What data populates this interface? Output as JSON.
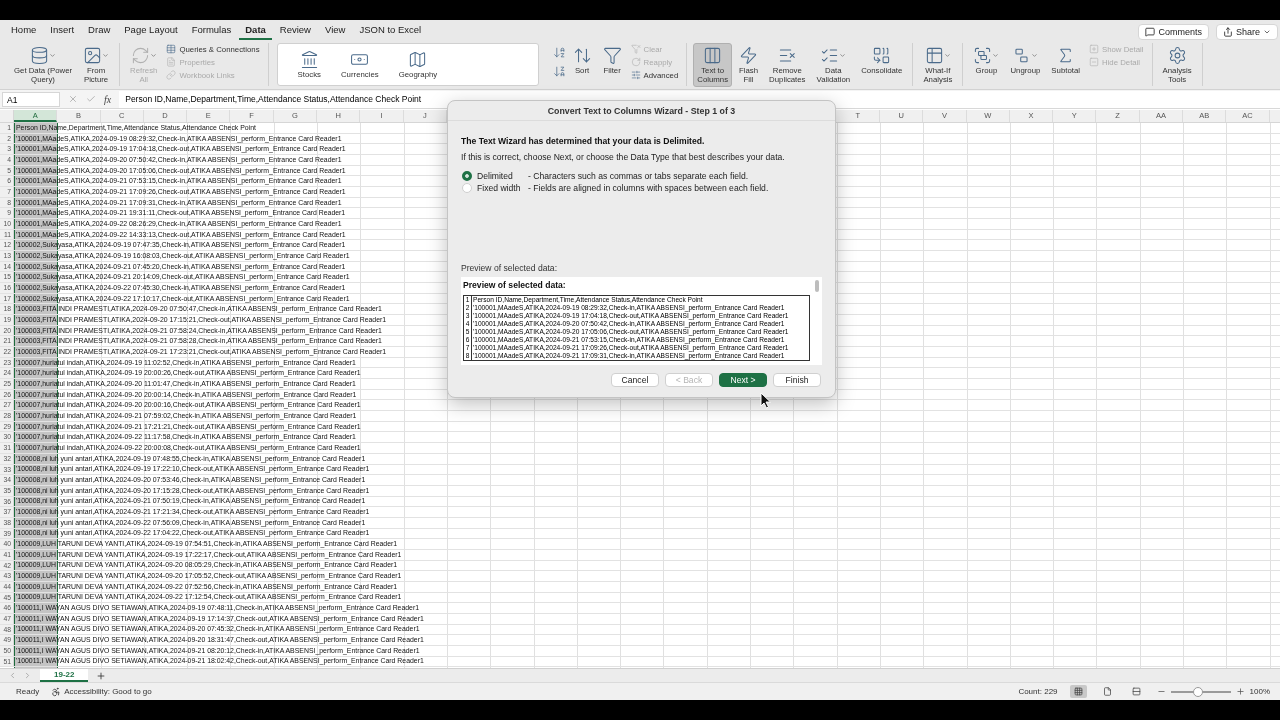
{
  "menu_tabs": [
    {
      "label": "Home",
      "selected": false
    },
    {
      "label": "Insert",
      "selected": false
    },
    {
      "label": "Draw",
      "selected": false
    },
    {
      "label": "Page Layout",
      "selected": false
    },
    {
      "label": "Formulas",
      "selected": false
    },
    {
      "label": "Data",
      "selected": true
    },
    {
      "label": "Review",
      "selected": false
    },
    {
      "label": "View",
      "selected": false
    },
    {
      "label": "JSON to Excel",
      "selected": false
    }
  ],
  "header_buttons": [
    {
      "label": "Comments",
      "kind": "comments"
    },
    {
      "label": "Share",
      "kind": "share"
    }
  ],
  "ribbon": [
    {
      "kind": "plain",
      "items": [
        {
          "label": "Get Data (Power\nQuery)",
          "kind": "large",
          "menu": true,
          "disabled": false,
          "pressed": false
        },
        {
          "label": "From\nPicture",
          "kind": "large",
          "menu": true,
          "disabled": false,
          "pressed": false
        }
      ]
    },
    {
      "kind": "plain",
      "items": [
        {
          "label": "Refresh\nAll",
          "kind": "large",
          "menu": true,
          "disabled": true,
          "pressed": false
        },
        {
          "label": "Queries & Connections",
          "kind": "small",
          "menu": false,
          "disabled": false,
          "pressed": false
        },
        {
          "label": "Properties",
          "kind": "small",
          "menu": false,
          "disabled": true,
          "pressed": false
        },
        {
          "label": "Workbook Links",
          "kind": "small",
          "menu": false,
          "disabled": true,
          "pressed": false
        }
      ]
    },
    {
      "kind": "panel",
      "items": [
        {
          "label": "Stocks",
          "kind": "large",
          "menu": false,
          "disabled": false,
          "pressed": false
        },
        {
          "label": "Currencies",
          "kind": "large",
          "menu": false,
          "disabled": false,
          "pressed": false
        },
        {
          "label": "Geography",
          "kind": "large",
          "menu": false,
          "disabled": false,
          "pressed": false
        }
      ]
    },
    {
      "kind": "sort",
      "items": [
        {
          "label": "Sort",
          "kind": "large",
          "menu": false,
          "disabled": false,
          "pressed": false
        },
        {
          "label": "Filter",
          "kind": "large",
          "menu": false,
          "disabled": false,
          "pressed": false
        },
        {
          "label": "Clear",
          "kind": "small",
          "menu": false,
          "disabled": true,
          "pressed": false
        },
        {
          "label": "Reapply",
          "kind": "small",
          "menu": false,
          "disabled": true,
          "pressed": false
        },
        {
          "label": "Advanced",
          "kind": "small",
          "menu": false,
          "disabled": false,
          "pressed": false
        }
      ]
    },
    {
      "kind": "plain",
      "items": [
        {
          "label": "Text to\nColumns",
          "kind": "large",
          "menu": false,
          "disabled": false,
          "pressed": true
        },
        {
          "label": "Flash\nFill",
          "kind": "large",
          "menu": false,
          "disabled": false,
          "pressed": false
        },
        {
          "label": "Remove\nDuplicates",
          "kind": "large",
          "menu": false,
          "disabled": false,
          "pressed": false
        },
        {
          "label": "Data\nValidation",
          "kind": "large",
          "menu": true,
          "disabled": false,
          "pressed": false
        },
        {
          "label": "Consolidate",
          "kind": "large",
          "menu": false,
          "disabled": false,
          "pressed": false
        }
      ]
    },
    {
      "kind": "plain",
      "items": [
        {
          "label": "What-If\nAnalysis",
          "kind": "large",
          "menu": true,
          "disabled": false,
          "pressed": false
        }
      ]
    },
    {
      "kind": "plain",
      "items": [
        {
          "label": "Group",
          "kind": "large",
          "menu": true,
          "disabled": false,
          "pressed": false
        },
        {
          "label": "Ungroup",
          "kind": "large",
          "menu": true,
          "disabled": false,
          "pressed": false
        },
        {
          "label": "Subtotal",
          "kind": "large",
          "menu": false,
          "disabled": false,
          "pressed": false
        },
        {
          "label": "Show Detail",
          "kind": "small",
          "menu": false,
          "disabled": true,
          "pressed": false
        },
        {
          "label": "Hide Detail",
          "kind": "small",
          "menu": false,
          "disabled": true,
          "pressed": false
        }
      ]
    },
    {
      "kind": "plain",
      "items": [
        {
          "label": "Analysis\nTools",
          "kind": "large",
          "menu": false,
          "disabled": false,
          "pressed": false
        }
      ]
    }
  ],
  "formula_bar": {
    "name_box": "A1",
    "function_button": "fx",
    "formula": "Person ID,Name,Department,Time,Attendance Status,Attendance Check Point"
  },
  "column_headers_left": [
    {
      "label": "A",
      "selected": true
    },
    {
      "label": "B",
      "selected": false
    },
    {
      "label": "C",
      "selected": false
    },
    {
      "label": "D",
      "selected": false
    },
    {
      "label": "E",
      "selected": false
    },
    {
      "label": "F",
      "selected": false
    },
    {
      "label": "G",
      "selected": false
    },
    {
      "label": "H",
      "selected": false
    },
    {
      "label": "I",
      "selected": false
    },
    {
      "label": "J",
      "selected": false
    }
  ],
  "column_headers_right": [
    {
      "label": "T",
      "selected": false
    },
    {
      "label": "U",
      "selected": false
    },
    {
      "label": "V",
      "selected": false
    },
    {
      "label": "W",
      "selected": false
    },
    {
      "label": "X",
      "selected": false
    },
    {
      "label": "Y",
      "selected": false
    },
    {
      "label": "Z",
      "selected": false
    },
    {
      "label": "AA",
      "selected": false
    },
    {
      "label": "AB",
      "selected": false
    },
    {
      "label": "AC",
      "selected": false
    }
  ],
  "rows": [
    {
      "number": "1",
      "text": "Person ID,Name,Department,Time,Attendance Status,Attendance Check Point"
    },
    {
      "number": "2",
      "text": "'100001,MAadeS,ATIKA,2024-09-19 08:29:32,Check-in,ATIKA ABSENSI_perform_Entrance Card Reader1"
    },
    {
      "number": "3",
      "text": "'100001,MAadeS,ATIKA,2024-09-19 17:04:18,Check-out,ATIKA ABSENSI_perform_Entrance Card Reader1"
    },
    {
      "number": "4",
      "text": "'100001,MAadeS,ATIKA,2024-09-20 07:50:42,Check-in,ATIKA ABSENSI_perform_Entrance Card Reader1"
    },
    {
      "number": "5",
      "text": "'100001,MAadeS,ATIKA,2024-09-20 17:05:06,Check-out,ATIKA ABSENSI_perform_Entrance Card Reader1"
    },
    {
      "number": "6",
      "text": "'100001,MAadeS,ATIKA,2024-09-21 07:53:15,Check-in,ATIKA ABSENSI_perform_Entrance Card Reader1"
    },
    {
      "number": "7",
      "text": "'100001,MAadeS,ATIKA,2024-09-21 17:09:26,Check-out,ATIKA ABSENSI_perform_Entrance Card Reader1"
    },
    {
      "number": "8",
      "text": "'100001,MAadeS,ATIKA,2024-09-21 17:09:31,Check-in,ATIKA ABSENSI_perform_Entrance Card Reader1"
    },
    {
      "number": "9",
      "text": "'100001,MAadeS,ATIKA,2024-09-21 19:31:11,Check-out,ATIKA ABSENSI_perform_Entrance Card Reader1"
    },
    {
      "number": "10",
      "text": "'100001,MAadeS,ATIKA,2024-09-22 08:26:29,Check-in,ATIKA ABSENSI_perform_Entrance Card Reader1"
    },
    {
      "number": "11",
      "text": "'100001,MAadeS,ATIKA,2024-09-22 14:33:13,Check-out,ATIKA ABSENSI_perform_Entrance Card Reader1"
    },
    {
      "number": "12",
      "text": "'100002,Sukayasa,ATIKA,2024-09-19 07:47:35,Check-in,ATIKA ABSENSI_perform_Entrance Card Reader1"
    },
    {
      "number": "13",
      "text": "'100002,Sukayasa,ATIKA,2024-09-19 16:08:03,Check-out,ATIKA ABSENSI_perform_Entrance Card Reader1"
    },
    {
      "number": "14",
      "text": "'100002,Sukayasa,ATIKA,2024-09-21 07:45:20,Check-in,ATIKA ABSENSI_perform_Entrance Card Reader1"
    },
    {
      "number": "15",
      "text": "'100002,Sukayasa,ATIKA,2024-09-21 20:14:09,Check-out,ATIKA ABSENSI_perform_Entrance Card Reader1"
    },
    {
      "number": "16",
      "text": "'100002,Sukayasa,ATIKA,2024-09-22 07:45:30,Check-in,ATIKA ABSENSI_perform_Entrance Card Reader1"
    },
    {
      "number": "17",
      "text": "'100002,Sukayasa,ATIKA,2024-09-22 17:10:17,Check-out,ATIKA ABSENSI_perform_Entrance Card Reader1"
    },
    {
      "number": "18",
      "text": "'100003,FITA INDI PRAMESTI,ATIKA,2024-09-20 07:50:47,Check-in,ATIKA ABSENSI_perform_Entrance Card Reader1"
    },
    {
      "number": "19",
      "text": "'100003,FITA INDI PRAMESTI,ATIKA,2024-09-20 17:15:21,Check-out,ATIKA ABSENSI_perform_Entrance Card Reader1"
    },
    {
      "number": "20",
      "text": "'100003,FITA INDI PRAMESTI,ATIKA,2024-09-21 07:58:24,Check-in,ATIKA ABSENSI_perform_Entrance Card Reader1"
    },
    {
      "number": "21",
      "text": "'100003,FITA INDI PRAMESTI,ATIKA,2024-09-21 07:58:28,Check-in,ATIKA ABSENSI_perform_Entrance Card Reader1"
    },
    {
      "number": "22",
      "text": "'100003,FITA INDI PRAMESTI,ATIKA,2024-09-21 17:23:21,Check-out,ATIKA ABSENSI_perform_Entrance Card Reader1"
    },
    {
      "number": "23",
      "text": "'100007,huriatul indah,ATIKA,2024-09-19 11:02:52,Check-in,ATIKA ABSENSI_perform_Entrance Card Reader1"
    },
    {
      "number": "24",
      "text": "'100007,huriatul indah,ATIKA,2024-09-19 20:00:26,Check-out,ATIKA ABSENSI_perform_Entrance Card Reader1"
    },
    {
      "number": "25",
      "text": "'100007,huriatul indah,ATIKA,2024-09-20 11:01:47,Check-in,ATIKA ABSENSI_perform_Entrance Card Reader1"
    },
    {
      "number": "26",
      "text": "'100007,huriatul indah,ATIKA,2024-09-20 20:00:14,Check-in,ATIKA ABSENSI_perform_Entrance Card Reader1"
    },
    {
      "number": "27",
      "text": "'100007,huriatul indah,ATIKA,2024-09-20 20:00:16,Check-out,ATIKA ABSENSI_perform_Entrance Card Reader1"
    },
    {
      "number": "28",
      "text": "'100007,huriatul indah,ATIKA,2024-09-21 07:59:02,Check-in,ATIKA ABSENSI_perform_Entrance Card Reader1"
    },
    {
      "number": "29",
      "text": "'100007,huriatul indah,ATIKA,2024-09-21 17:21:21,Check-out,ATIKA ABSENSI_perform_Entrance Card Reader1"
    },
    {
      "number": "30",
      "text": "'100007,huriatul indah,ATIKA,2024-09-22 11:17:58,Check-in,ATIKA ABSENSI_perform_Entrance Card Reader1"
    },
    {
      "number": "31",
      "text": "'100007,huriatul indah,ATIKA,2024-09-22 20:00:08,Check-out,ATIKA ABSENSI_perform_Entrance Card Reader1"
    },
    {
      "number": "32",
      "text": "'100008,ni luh yuni antari,ATIKA,2024-09-19 07:48:55,Check-in,ATIKA ABSENSI_perform_Entrance Card Reader1"
    },
    {
      "number": "33",
      "text": "'100008,ni luh yuni antari,ATIKA,2024-09-19 17:22:10,Check-out,ATIKA ABSENSI_perform_Entrance Card Reader1"
    },
    {
      "number": "34",
      "text": "'100008,ni luh yuni antari,ATIKA,2024-09-20 07:53:46,Check-in,ATIKA ABSENSI_perform_Entrance Card Reader1"
    },
    {
      "number": "35",
      "text": "'100008,ni luh yuni antari,ATIKA,2024-09-20 17:15:28,Check-out,ATIKA ABSENSI_perform_Entrance Card Reader1"
    },
    {
      "number": "36",
      "text": "'100008,ni luh yuni antari,ATIKA,2024-09-21 07:50:19,Check-in,ATIKA ABSENSI_perform_Entrance Card Reader1"
    },
    {
      "number": "37",
      "text": "'100008,ni luh yuni antari,ATIKA,2024-09-21 17:21:34,Check-out,ATIKA ABSENSI_perform_Entrance Card Reader1"
    },
    {
      "number": "38",
      "text": "'100008,ni luh yuni antari,ATIKA,2024-09-22 07:56:09,Check-in,ATIKA ABSENSI_perform_Entrance Card Reader1"
    },
    {
      "number": "39",
      "text": "'100008,ni luh yuni antari,ATIKA,2024-09-22 17:04:22,Check-out,ATIKA ABSENSI_perform_Entrance Card Reader1"
    },
    {
      "number": "40",
      "text": "'100009,LUH TARUNI DEVA YANTI,ATIKA,2024-09-19 07:54:51,Check-in,ATIKA ABSENSI_perform_Entrance Card Reader1"
    },
    {
      "number": "41",
      "text": "'100009,LUH TARUNI DEVA YANTI,ATIKA,2024-09-19 17:22:17,Check-out,ATIKA ABSENSI_perform_Entrance Card Reader1"
    },
    {
      "number": "42",
      "text": "'100009,LUH TARUNI DEVA YANTI,ATIKA,2024-09-20 08:05:29,Check-in,ATIKA ABSENSI_perform_Entrance Card Reader1"
    },
    {
      "number": "43",
      "text": "'100009,LUH TARUNI DEVA YANTI,ATIKA,2024-09-20 17:05:52,Check-out,ATIKA ABSENSI_perform_Entrance Card Reader1"
    },
    {
      "number": "44",
      "text": "'100009,LUH TARUNI DEVA YANTI,ATIKA,2024-09-22 07:52:56,Check-in,ATIKA ABSENSI_perform_Entrance Card Reader1"
    },
    {
      "number": "45",
      "text": "'100009,LUH TARUNI DEVA YANTI,ATIKA,2024-09-22 17:12:54,Check-out,ATIKA ABSENSI_perform_Entrance Card Reader1"
    },
    {
      "number": "46",
      "text": "'100011,I WAYAN AGUS DIVO SETIAWAN,ATIKA,2024-09-19 07:48:11,Check-in,ATIKA ABSENSI_perform_Entrance Card Reader1"
    },
    {
      "number": "47",
      "text": "'100011,I WAYAN AGUS DIVO SETIAWAN,ATIKA,2024-09-19 17:14:37,Check-out,ATIKA ABSENSI_perform_Entrance Card Reader1"
    },
    {
      "number": "48",
      "text": "'100011,I WAYAN AGUS DIVO SETIAWAN,ATIKA,2024-09-20 07:45:32,Check-in,ATIKA ABSENSI_perform_Entrance Card Reader1"
    },
    {
      "number": "49",
      "text": "'100011,I WAYAN AGUS DIVO SETIAWAN,ATIKA,2024-09-20 18:31:47,Check-out,ATIKA ABSENSI_perform_Entrance Card Reader1"
    },
    {
      "number": "50",
      "text": "'100011,I WAYAN AGUS DIVO SETIAWAN,ATIKA,2024-09-21 08:20:12,Check-in,ATIKA ABSENSI_perform_Entrance Card Reader1"
    },
    {
      "number": "51",
      "text": "'100011,I WAYAN AGUS DIVO SETIAWAN,ATIKA,2024-09-21 18:02:42,Check-out,ATIKA ABSENSI_perform_Entrance Card Reader1"
    }
  ],
  "sheet_tabs": [
    {
      "label": "19-22",
      "selected": true
    }
  ],
  "status_bar": {
    "mode": "Ready",
    "accessibility": "Accessibility: Good to go",
    "count": "Count: 229",
    "views": [
      {
        "kind": "normal",
        "selected": true
      },
      {
        "kind": "page-layout",
        "selected": false
      },
      {
        "kind": "page-break",
        "selected": false
      }
    ],
    "zoom": {
      "level": 0.45,
      "reading": "100%"
    }
  },
  "dialog": {
    "title": "Convert Text to Columns Wizard - Step 1 of 3",
    "heading": "The Text Wizard has determined that your data is Delimited.",
    "instruction": "If this is correct, choose Next, or choose the Data Type that best describes your data.",
    "options": [
      {
        "label": "Delimited",
        "description": "- Characters such as commas or tabs separate each field.",
        "selected": true
      },
      {
        "label": "Fixed width",
        "description": "- Fields are aligned in columns with spaces between each field.",
        "selected": false
      }
    ],
    "preview_label": "Preview of selected data:",
    "preview_heading": "Preview of selected data:",
    "preview_lines": [
      {
        "number": "1",
        "text": "Person ID,Name,Department,Time,Attendance Status,Attendance Check Point"
      },
      {
        "number": "2",
        "text": "'100001,MAadeS,ATIKA,2024-09-19 08:29:32,Check-in,ATIKA ABSENSI_perform_Entrance Card Reader1"
      },
      {
        "number": "3",
        "text": "'100001,MAadeS,ATIKA,2024-09-19 17:04:18,Check-out,ATIKA ABSENSI_perform_Entrance Card Reader1"
      },
      {
        "number": "4",
        "text": "'100001,MAadeS,ATIKA,2024-09-20 07:50:42,Check-in,ATIKA ABSENSI_perform_Entrance Card Reader1"
      },
      {
        "number": "5",
        "text": "'100001,MAadeS,ATIKA,2024-09-20 17:05:06,Check-out,ATIKA ABSENSI_perform_Entrance Card Reader1"
      },
      {
        "number": "6",
        "text": "'100001,MAadeS,ATIKA,2024-09-21 07:53:15,Check-in,ATIKA ABSENSI_perform_Entrance Card Reader1"
      },
      {
        "number": "7",
        "text": "'100001,MAadeS,ATIKA,2024-09-21 17:09:26,Check-out,ATIKA ABSENSI_perform_Entrance Card Reader1"
      },
      {
        "number": "8",
        "text": "'100001,MAadeS,ATIKA,2024-09-21 17:09:31,Check-in,ATIKA ABSENSI_perform_Entrance Card Reader1"
      }
    ],
    "buttons": [
      {
        "label": "Cancel",
        "kind": "normal",
        "disabled": false
      },
      {
        "label": "< Back",
        "kind": "normal",
        "disabled": true
      },
      {
        "label": "Next >",
        "kind": "primary",
        "disabled": false
      },
      {
        "label": "Finish",
        "kind": "normal",
        "disabled": false
      }
    ]
  }
}
